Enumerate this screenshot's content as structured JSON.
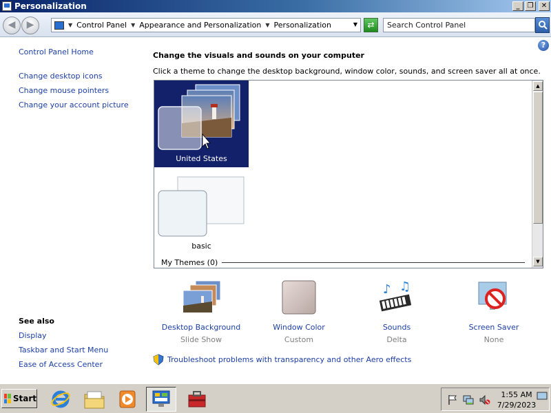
{
  "window": {
    "title": "Personalization"
  },
  "address": {
    "breadcrumbs": [
      "Control Panel",
      "Appearance and Personalization",
      "Personalization"
    ],
    "search_placeholder": "Search Control Panel"
  },
  "sidebar": {
    "home": "Control Panel Home",
    "links": [
      "Change desktop icons",
      "Change mouse pointers",
      "Change your account picture"
    ],
    "see_also_title": "See also",
    "see_also": [
      "Display",
      "Taskbar and Start Menu",
      "Ease of Access Center"
    ]
  },
  "main": {
    "heading": "Change the visuals and sounds on your computer",
    "description": "Click a theme to change the desktop background, window color, sounds, and screen saver all at once.",
    "themes": [
      {
        "name": "United States",
        "selected": true
      },
      {
        "name": "basic",
        "selected": false
      }
    ],
    "my_themes_label": "My Themes (0)"
  },
  "tiles": [
    {
      "name": "Desktop Background",
      "value": "Slide Show",
      "icon": "landscape-icon"
    },
    {
      "name": "Window Color",
      "value": "Custom",
      "icon": "window-color-icon"
    },
    {
      "name": "Sounds",
      "value": "Delta",
      "icon": "sounds-icon"
    },
    {
      "name": "Screen Saver",
      "value": "None",
      "icon": "screen-saver-icon"
    }
  ],
  "troubleshoot": "Troubleshoot problems with transparency and other Aero effects",
  "taskbar": {
    "start_label": "Start",
    "time": "1:55 AM",
    "date": "7/29/2023"
  },
  "colors": {
    "link": "#1c3ea6",
    "selection": "#13206a",
    "titlebar": "#0a246a"
  }
}
